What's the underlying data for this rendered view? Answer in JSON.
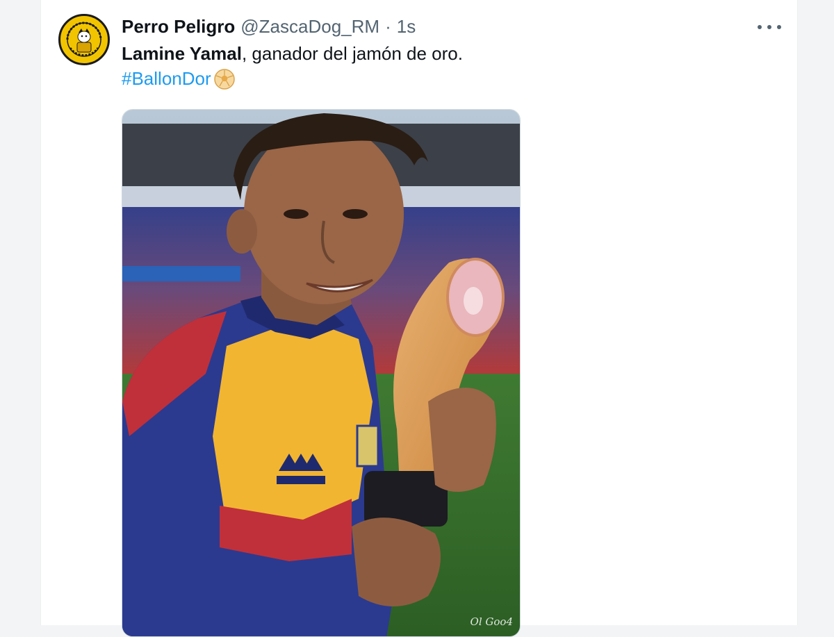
{
  "tweet": {
    "author_name": "Perro Peligro",
    "handle": "@ZascaDog_RM",
    "separator": "·",
    "time": "1s",
    "text_bold": "Lamine Yamal",
    "text_rest": ", ganador del jamón de oro.",
    "hashtag": "#BallonDor",
    "media_watermark": "Ol Goo4"
  },
  "icons": {
    "avatar": "dog-logo-avatar",
    "more": "more-options-icon",
    "ball": "soccer-ball-emoji"
  },
  "colors": {
    "link": "#1d9bf0",
    "text": "#0f1419",
    "muted": "#536471",
    "avatar_bg": "#f2c400"
  }
}
